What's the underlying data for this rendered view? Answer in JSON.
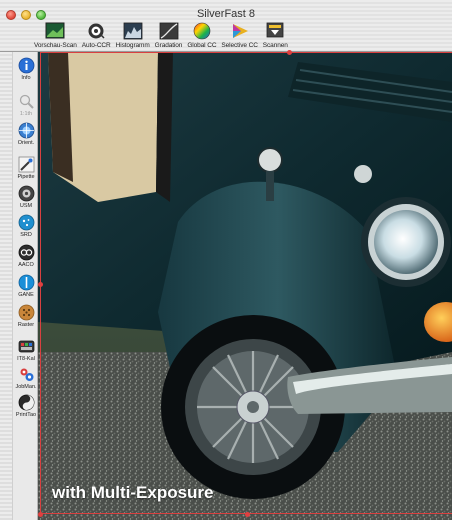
{
  "window": {
    "title": "SilverFast 8",
    "traffic_lights": [
      "close",
      "minimize",
      "zoom"
    ]
  },
  "toolbar": {
    "items": [
      {
        "label": "Vorschau-Scan",
        "icon": "preview-scan-icon"
      },
      {
        "label": "Auto-CCR",
        "icon": "auto-ccr-icon"
      },
      {
        "label": "Histogramm",
        "icon": "histogram-icon"
      },
      {
        "label": "Gradation",
        "icon": "gradation-icon"
      },
      {
        "label": "Global CC",
        "icon": "global-cc-icon"
      },
      {
        "label": "Selective CC",
        "icon": "selective-cc-icon"
      },
      {
        "label": "Scannen",
        "icon": "scan-icon"
      }
    ]
  },
  "palette": {
    "items": [
      {
        "label": "Info",
        "icon": "info-icon"
      },
      {
        "label": "1:1th",
        "icon": "zoom-icon",
        "disabled": true
      },
      {
        "label": "Orient.",
        "icon": "orientation-icon"
      },
      {
        "label": "Pipette",
        "icon": "pipette-icon"
      },
      {
        "label": "USM",
        "icon": "usm-icon"
      },
      {
        "label": "SRD",
        "icon": "srd-icon"
      },
      {
        "label": "AACO",
        "icon": "aaco-icon"
      },
      {
        "label": "GANE",
        "icon": "gane-icon"
      },
      {
        "label": "Raster",
        "icon": "raster-icon"
      },
      {
        "label": "IT8-Kal",
        "icon": "it8-calibration-icon"
      },
      {
        "label": "JobMan.",
        "icon": "job-manager-icon"
      },
      {
        "label": "PrintTao",
        "icon": "printtao-icon"
      }
    ]
  },
  "preview": {
    "caption": "with Multi-Exposure",
    "subject": "vintage car scan preview"
  },
  "colors": {
    "frame": "#d94040",
    "caption": "#ffffff"
  }
}
